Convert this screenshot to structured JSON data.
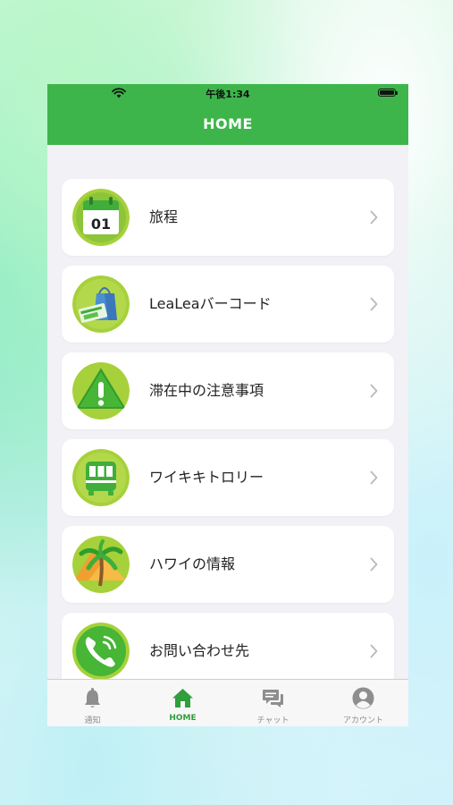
{
  "status_bar": {
    "time": "午後1:34"
  },
  "header": {
    "title": "HOME"
  },
  "menu": {
    "items": [
      {
        "label": "旅程",
        "icon": "calendar-icon",
        "icon_text": "01"
      },
      {
        "label": "LeaLeaバーコード",
        "icon": "shopping-bag-icon"
      },
      {
        "label": "滞在中の注意事項",
        "icon": "warning-icon"
      },
      {
        "label": "ワイキキトロリー",
        "icon": "trolley-icon"
      },
      {
        "label": "ハワイの情報",
        "icon": "palm-tree-icon"
      },
      {
        "label": "お問い合わせ先",
        "icon": "phone-icon"
      }
    ]
  },
  "tab_bar": {
    "tabs": [
      {
        "label": "通知",
        "icon": "bell-icon",
        "active": false
      },
      {
        "label": "HOME",
        "icon": "home-icon",
        "active": true
      },
      {
        "label": "チャット",
        "icon": "chat-icon",
        "active": false
      },
      {
        "label": "アカウント",
        "icon": "account-icon",
        "active": false
      }
    ]
  },
  "colors": {
    "brand_green": "#3db54a",
    "icon_lime": "#a6d13a",
    "icon_green": "#47b535",
    "tab_active": "#2f9e3b",
    "tab_inactive": "#8e8e8e"
  }
}
